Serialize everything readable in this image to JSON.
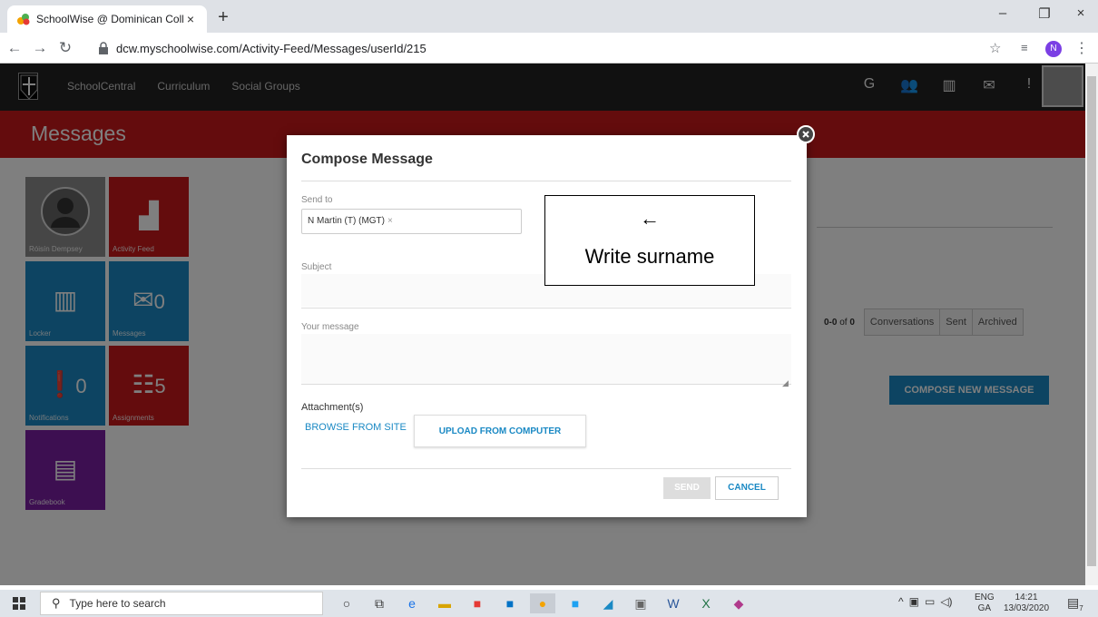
{
  "browser": {
    "tab_title": "SchoolWise @ Dominican Colleg",
    "tab_close": "×",
    "new_tab": "+",
    "url": "dcw.myschoolwise.com/Activity-Feed/Messages/userId/215",
    "profile_initial": "N",
    "window": {
      "minimize": "–",
      "restore": "❐",
      "close": "×"
    }
  },
  "site": {
    "nav_links": [
      "SchoolCentral",
      "Curriculum",
      "Social Groups"
    ],
    "page_title": "Messages",
    "tiles": {
      "profile_label": "Róisín Dempsey",
      "activity_label": "Activity Feed",
      "locker_label": "Locker",
      "messages_label": "Messages",
      "messages_count": "0",
      "notifications_label": "Notifications",
      "notifications_count": "0",
      "assignments_label": "Assignments",
      "assignments_count": "5",
      "gradebook_label": "Gradebook"
    },
    "count": {
      "range": "0-0",
      "of": "of",
      "total": "0"
    },
    "filters": [
      "Conversations",
      "Sent",
      "Archived"
    ],
    "compose_button": "COMPOSE NEW MESSAGE",
    "colors": {
      "brand_red": "#c9191b",
      "blue_tile": "#1a89c4",
      "purple_tile": "#7b1fa2"
    }
  },
  "modal": {
    "title": "Compose Message",
    "send_to_label": "Send to",
    "recipient": "N Martin (T) (MGT)",
    "recipient_remove": "×",
    "subject_label": "Subject",
    "message_label": "Your message",
    "attachments_label": "Attachment(s)",
    "browse_label": "BROWSE FROM SITE",
    "upload_label": "UPLOAD FROM COMPUTER",
    "send_label": "SEND",
    "cancel_label": "CANCEL"
  },
  "annotation": {
    "arrow": "←",
    "text": "Write surname"
  },
  "taskbar": {
    "search_placeholder": "Type here to search",
    "lang_top": "ENG",
    "lang_bottom": "GA",
    "time": "14:21",
    "date": "13/03/2020",
    "notif_count": "7"
  }
}
